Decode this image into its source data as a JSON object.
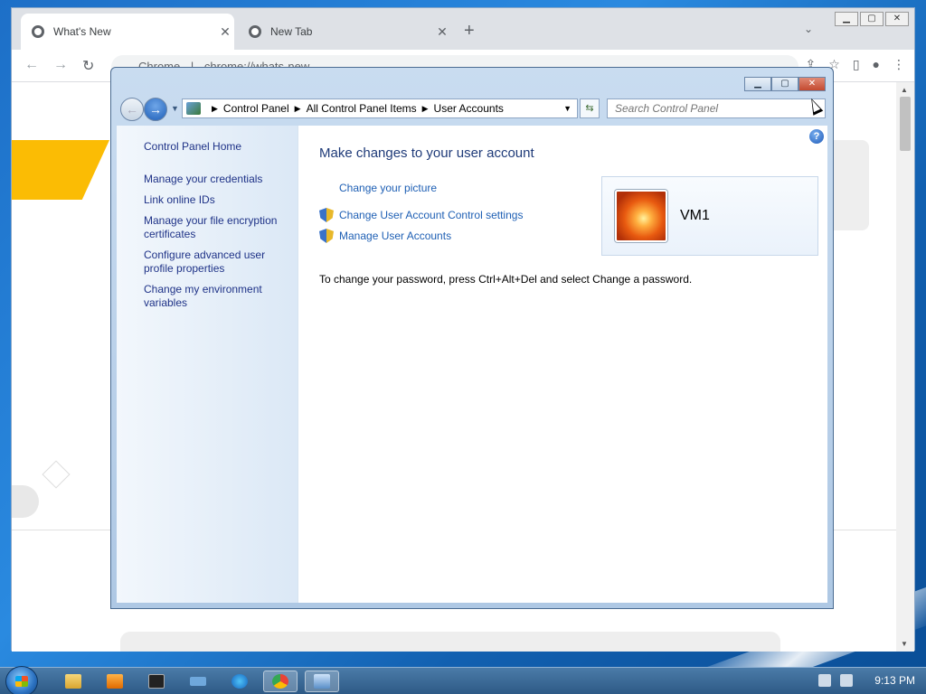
{
  "chrome": {
    "tabs": [
      {
        "title": "What's New",
        "active": true
      },
      {
        "title": "New Tab",
        "active": false
      }
    ],
    "address": "chrome://whats-new",
    "site_label": "Chrome"
  },
  "control_panel": {
    "breadcrumb": [
      "Control Panel",
      "All Control Panel Items",
      "User Accounts"
    ],
    "search_placeholder": "Search Control Panel",
    "left_links": [
      "Control Panel Home",
      "Manage your credentials",
      "Link online IDs",
      "Manage your file encryption certificates",
      "Configure advanced user profile properties",
      "Change my environment variables"
    ],
    "heading": "Make changes to your user account",
    "tasks": [
      {
        "label": "Change your picture",
        "shield": false
      },
      {
        "label": "Change User Account Control settings",
        "shield": true
      },
      {
        "label": "Manage User Accounts",
        "shield": true
      }
    ],
    "user_name": "VM1",
    "password_note": "To change your password, press Ctrl+Alt+Del and select Change a password."
  },
  "taskbar": {
    "apps": [
      "file-explorer-icon",
      "media-player-icon",
      "terminal-icon",
      "keyboard-icon",
      "edge-icon",
      "chrome-icon",
      "control-panel-icon"
    ],
    "clock": "9:13 PM"
  }
}
